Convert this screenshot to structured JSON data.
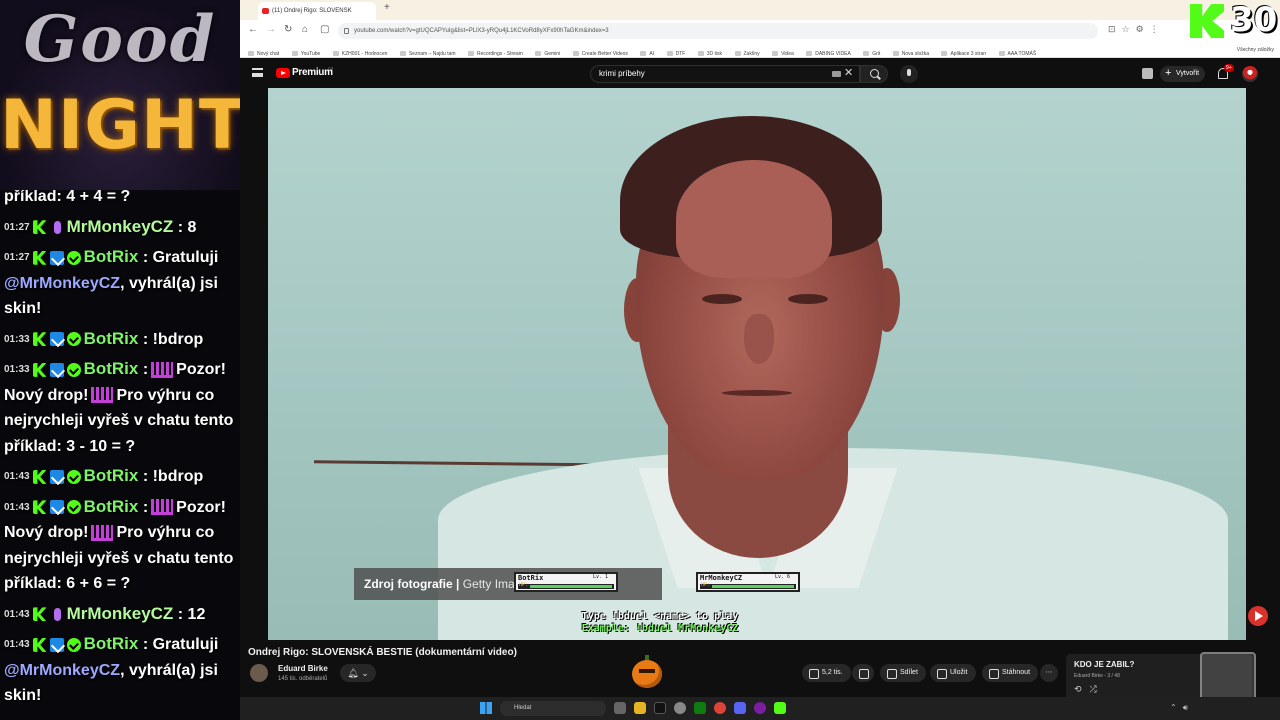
{
  "overlay": {
    "banner_top": "Good",
    "banner_bottom": "NIGHT",
    "kick_counter": "30"
  },
  "chat": [
    {
      "time": "",
      "badges": [],
      "user": "",
      "text": "příklad: 4 + 4 = ?"
    },
    {
      "time": "01:27",
      "badges": [
        "kick",
        "mic"
      ],
      "user": "MrMonkeyCZ",
      "text": ": 8"
    },
    {
      "time": "01:27",
      "badges": [
        "kick",
        "mod",
        "verified"
      ],
      "user": "BotRix",
      "text": ": Gratuluji",
      "mention": "@MrMonkeyCZ",
      "text2": ", vyhrál(a) jsi skin!"
    },
    {
      "time": "01:33",
      "badges": [
        "kick",
        "mod",
        "verified"
      ],
      "user": "BotRix",
      "text": ": !bdrop"
    },
    {
      "time": "01:33",
      "badges": [
        "kick",
        "mod",
        "verified"
      ],
      "user": "BotRix",
      "text": ":",
      "text2": "Pozor! Nový drop!",
      "text3": "Pro výhru co nejrychleji vyřeš v chatu tento příklad: 3 - 10 = ?"
    },
    {
      "time": "01:43",
      "badges": [
        "kick",
        "mod",
        "verified"
      ],
      "user": "BotRix",
      "text": ": !bdrop"
    },
    {
      "time": "01:43",
      "badges": [
        "kick",
        "mod",
        "verified"
      ],
      "user": "BotRix",
      "text": ":",
      "text2": "Pozor! Nový drop!",
      "text3": "Pro výhru co nejrychleji vyřeš v chatu tento příklad: 6 + 6 = ?"
    },
    {
      "time": "01:43",
      "badges": [
        "kick",
        "mic"
      ],
      "user": "MrMonkeyCZ",
      "text": ": 12"
    },
    {
      "time": "01:43",
      "badges": [
        "kick",
        "mod",
        "verified"
      ],
      "user": "BotRix",
      "text": ": Gratuluji",
      "mention": "@MrMonkeyCZ",
      "text2": ", vyhrál(a) jsi skin!"
    }
  ],
  "browser": {
    "tab_title": "(11) Ondrej Rigo: SLOVENSK",
    "url": "youtube.com/watch?v=gtUQCAPYuIg&list=PLlX3-yRQu4jL1KCVoRd8yXFx90hTaGKm&index=3",
    "bookmarks": [
      "Nový chat",
      "YouTube",
      "KZH001 - Hodnocen",
      "Seznam – Najdu tam",
      "Recordings - Stream",
      "Gemini",
      "Create Better Videos",
      "AI",
      "DTF",
      "3D tisk",
      "Zaklíny",
      "Videa",
      "DABING VIDEA",
      "Grit",
      "Nova složka",
      "Aplikace 3 stran",
      "AAA TOMÁŠ"
    ],
    "bookmarks_all": "Všechny záložky"
  },
  "youtube": {
    "brand": "Premium",
    "region": "CZ",
    "search_query": "krimi príbehy",
    "create_label": "Vytvořit",
    "notif_count": "9+",
    "video_title": "Ondrej Rigo: SLOVENSKÁ BESTIE (dokumentární video)",
    "channel_name": "Eduard Birke",
    "channel_subs": "145 tis. odběratelů",
    "likes": "5,2 tis.",
    "share_label": "Sdílet",
    "save_label": "Uložit",
    "download_label": "Stáhnout",
    "sidebar_title": "KDO JE ZABIL?",
    "sidebar_sub": "Eduard Birke - 3 / 48"
  },
  "video_overlay": {
    "source_bold": "Zdroj fotografie |",
    "source_rest": "Getty Images Archive",
    "duel_a_name": "BotRix",
    "duel_a_level": "Lv. 1",
    "duel_b_name": "MrMonkeyCZ",
    "duel_b_level": "Lv. 6",
    "hp_label": "HP:",
    "hint_line1": "Type !bduel <name> to play",
    "hint_line2": "Example: !bduel MrMonkeyCZ"
  },
  "taskbar": {
    "search_placeholder": "Hledat"
  },
  "colors": {
    "kick_green": "#53fc18",
    "youtube_red": "#ff0000",
    "night_gold": "#f4b73a"
  }
}
